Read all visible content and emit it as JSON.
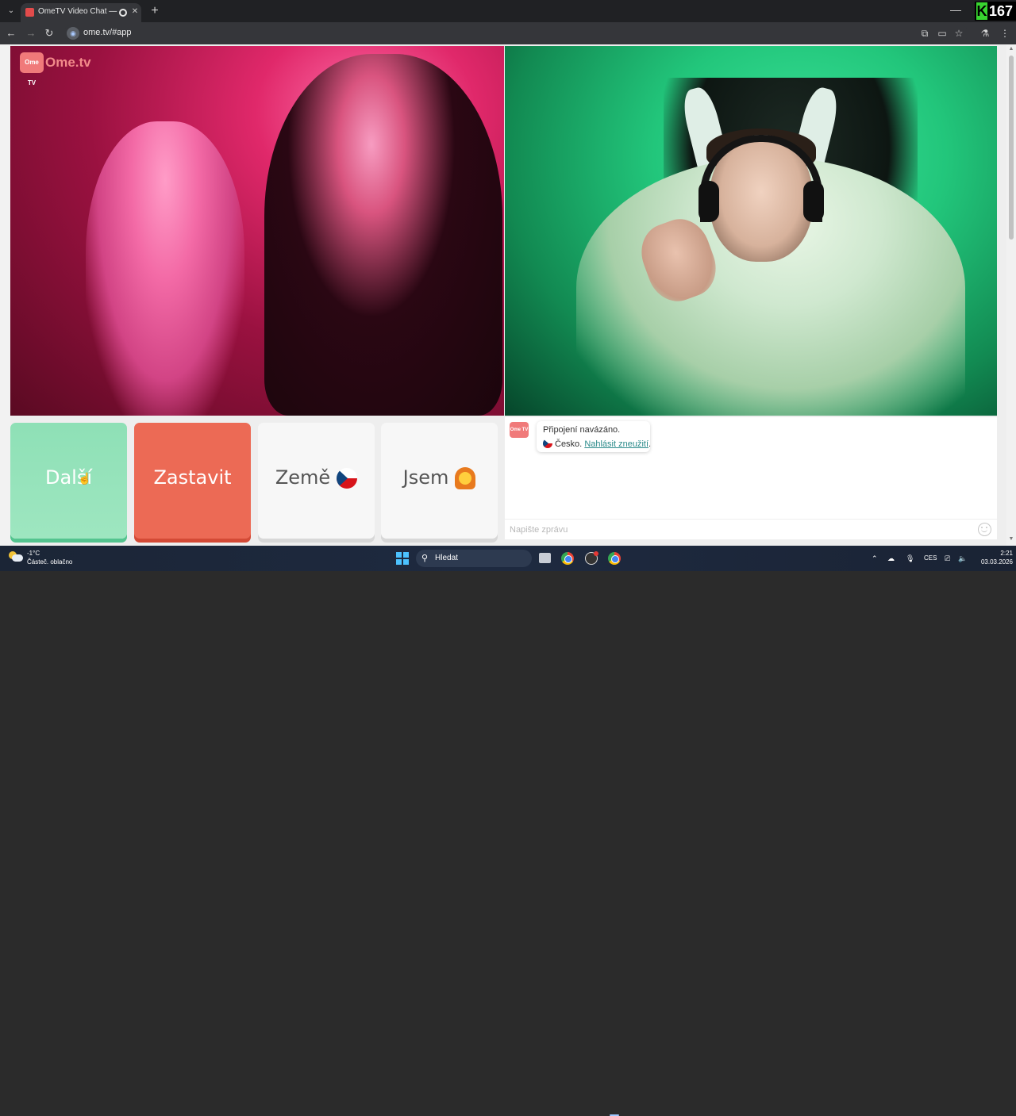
{
  "browser": {
    "tab_title": "OmeTV Video Chat — Ome",
    "tab_close": "✕",
    "new_tab": "+",
    "minimize": "—",
    "url": "ome.tv/#app",
    "extension_badge": {
      "letter": "K",
      "count": "167",
      "color": "#38d430"
    },
    "nav_icons": [
      "back-icon",
      "forward-icon",
      "reload-icon"
    ],
    "toolbar_icons": [
      "translate-icon",
      "cast-icon",
      "star-icon",
      "labs-icon",
      "menu-icon"
    ]
  },
  "app": {
    "logo_text": "Ome.tv",
    "logo_badge": "Ome TV",
    "buttons": {
      "next": "Další",
      "stop": "Zastavit",
      "country": "Země",
      "gender": "Jsem"
    },
    "colors": {
      "next": "#8ee0b6",
      "stop": "#ec6a55",
      "neutral": "#f7f7f7"
    },
    "chat": {
      "logo": "Ome TV",
      "message_line1": "Připojení navázáno.",
      "country": "Česko.",
      "report_link": "Nahlásit zneužití",
      "report_suffix": ".",
      "input_placeholder": "Napište zprávu"
    }
  },
  "taskbar": {
    "temperature": "-1°C",
    "weather": "Částeč. oblačno",
    "search_placeholder": "Hledat",
    "language": "CES",
    "time": "2:21",
    "date": "03.03.2026"
  }
}
